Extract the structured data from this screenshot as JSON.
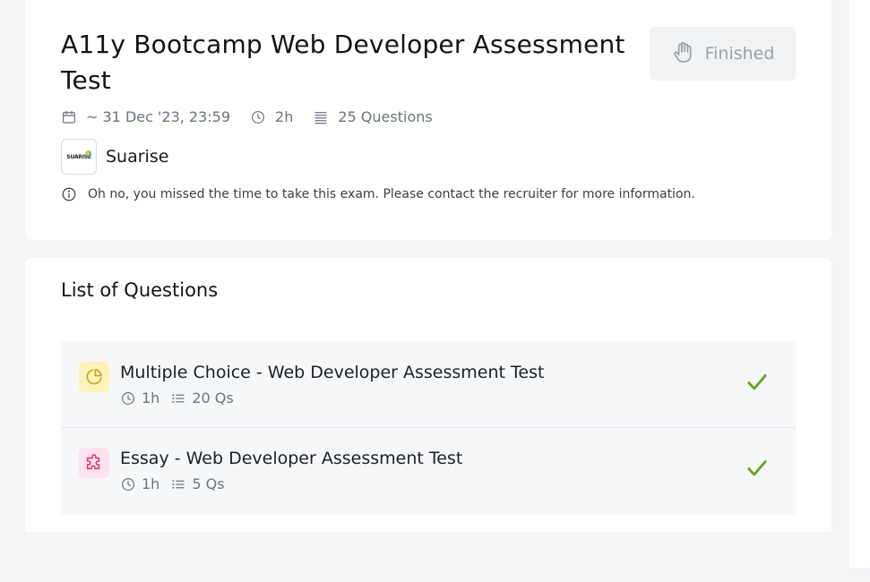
{
  "exam": {
    "title": "A11y Bootcamp Web Developer Assessment Test",
    "status_label": "Finished",
    "deadline": "~ 31 Dec '23, 23:59",
    "duration": "2h",
    "question_count": "25 Questions",
    "company_logo_text": "SUARISE",
    "company_name": "Suarise",
    "notice": "Oh no, you missed the time to take this exam. Please contact the recruiter for more information."
  },
  "questions": {
    "heading": "List of Questions",
    "items": [
      {
        "title": "Multiple Choice - Web Developer Assessment Test",
        "duration": "1h",
        "count": "20 Qs",
        "icon": "pie-chart-icon",
        "icon_bg": "#fdf2b8",
        "icon_color": "#c9a21b",
        "completed": true
      },
      {
        "title": "Essay - Web Developer Assessment Test",
        "duration": "1h",
        "count": "5 Qs",
        "icon": "puzzle-icon",
        "icon_bg": "#fde2ee",
        "icon_color": "#d6337a",
        "completed": true
      }
    ]
  },
  "colors": {
    "check": "#6aa51c",
    "muted": "#6b7280"
  }
}
